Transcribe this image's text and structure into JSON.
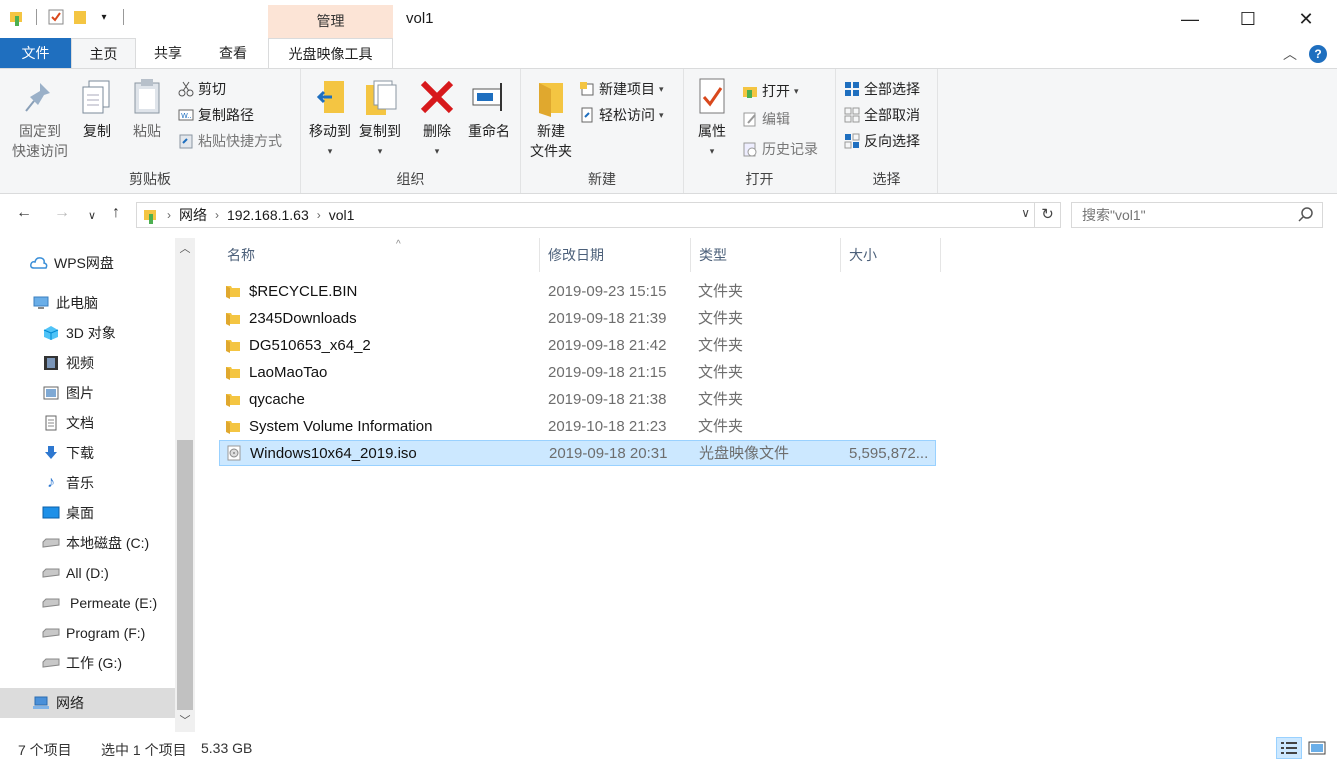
{
  "window": {
    "title": "vol1",
    "context_tab": "管理",
    "minimize": "—",
    "maximize": "☐",
    "close": "✕"
  },
  "tabs": {
    "file": "文件",
    "home": "主页",
    "share": "共享",
    "view": "查看",
    "disc": "光盘映像工具"
  },
  "ribbon": {
    "clipboard": {
      "label": "剪贴板",
      "pin_line1": "固定到",
      "pin_line2": "快速访问",
      "copy": "复制",
      "paste": "粘贴",
      "cut": "剪切",
      "copy_path": "复制路径",
      "paste_shortcut": "粘贴快捷方式"
    },
    "organize": {
      "label": "组织",
      "move_to": "移动到",
      "copy_to": "复制到",
      "delete": "删除",
      "rename": "重命名"
    },
    "new": {
      "label": "新建",
      "new_folder_line1": "新建",
      "new_folder_line2": "文件夹",
      "new_item": "新建项目",
      "easy_access": "轻松访问"
    },
    "open": {
      "label": "打开",
      "properties": "属性",
      "open": "打开",
      "edit": "编辑",
      "history": "历史记录"
    },
    "select": {
      "label": "选择",
      "select_all": "全部选择",
      "select_none": "全部取消",
      "invert": "反向选择"
    }
  },
  "address": {
    "crumbs": [
      "网络",
      "192.168.1.63",
      "vol1"
    ],
    "search_placeholder": "搜索\"vol1\""
  },
  "nav": {
    "items": [
      {
        "label": "WPS网盘",
        "icon": "cloud-icon"
      },
      {
        "label": "此电脑",
        "icon": "computer-icon"
      },
      {
        "label": "3D 对象",
        "icon": "cube-icon"
      },
      {
        "label": "视频",
        "icon": "video-icon"
      },
      {
        "label": "图片",
        "icon": "picture-icon"
      },
      {
        "label": "文档",
        "icon": "document-icon"
      },
      {
        "label": "下载",
        "icon": "download-icon"
      },
      {
        "label": "音乐",
        "icon": "music-icon"
      },
      {
        "label": "桌面",
        "icon": "desktop-icon"
      },
      {
        "label": "本地磁盘 (C:)",
        "icon": "drive-icon"
      },
      {
        "label": "All (D:)",
        "icon": "drive-icon"
      },
      {
        "label": "Permeate (E:)",
        "icon": "drive-icon"
      },
      {
        "label": "Program (F:)",
        "icon": "drive-icon"
      },
      {
        "label": "工作 (G:)",
        "icon": "drive-icon"
      },
      {
        "label": "网络",
        "icon": "network-icon"
      }
    ]
  },
  "columns": {
    "name": "名称",
    "date": "修改日期",
    "type": "类型",
    "size": "大小"
  },
  "files": [
    {
      "name": "$RECYCLE.BIN",
      "date": "2019-09-23 15:15",
      "type": "文件夹",
      "size": ""
    },
    {
      "name": "2345Downloads",
      "date": "2019-09-18 21:39",
      "type": "文件夹",
      "size": ""
    },
    {
      "name": "DG510653_x64_2",
      "date": "2019-09-18 21:42",
      "type": "文件夹",
      "size": ""
    },
    {
      "name": "LaoMaoTao",
      "date": "2019-09-18 21:15",
      "type": "文件夹",
      "size": ""
    },
    {
      "name": "qycache",
      "date": "2019-09-18 21:38",
      "type": "文件夹",
      "size": ""
    },
    {
      "name": "System Volume Information",
      "date": "2019-10-18 21:23",
      "type": "文件夹",
      "size": ""
    },
    {
      "name": "Windows10x64_2019.iso",
      "date": "2019-09-18 20:31",
      "type": "光盘映像文件",
      "size": "5,595,872..."
    }
  ],
  "status": {
    "count": "7 个项目",
    "selected": "选中 1 个项目",
    "size": "5.33 GB"
  },
  "colors": {
    "accent": "#1f6fbf",
    "selection": "#cce8ff",
    "context_tab": "#fce4d6",
    "folder": "#f4c542"
  }
}
